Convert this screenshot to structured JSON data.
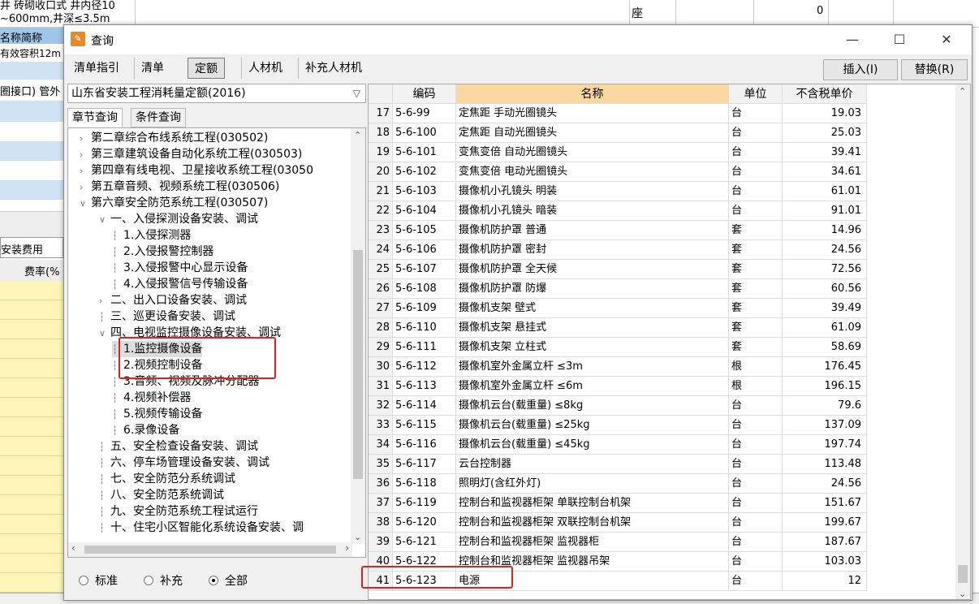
{
  "background": {
    "top_text_1": "井 砖砌收口式 井内径10",
    "top_text_2": "~600mm,井深≤3.5m",
    "top_unit": "座",
    "top_value": "0",
    "col_header": "名称简称",
    "row_a": "有效容积12m",
    "row_b": "圈接口) 管外",
    "fee_tab": "安装费用",
    "fee_rate": "费率(%"
  },
  "window": {
    "title": "查询",
    "minimize": "—",
    "maximize": "☐",
    "close": "✕"
  },
  "tabs": [
    {
      "label": "清单指引"
    },
    {
      "label": "清单"
    },
    {
      "label": "定额"
    },
    {
      "label": "人材机"
    },
    {
      "label": "补充人材机"
    }
  ],
  "buttons": {
    "insert": "插入(I)",
    "replace": "替换(R)"
  },
  "library": "山东省安装工程消耗量定额(2016)",
  "search_tabs": [
    "章节查询",
    "条件查询"
  ],
  "tree": [
    {
      "label": "第二章综合布线系统工程(030502)",
      "toggle": ">"
    },
    {
      "label": "第三章建筑设备自动化系统工程(030503)",
      "toggle": ">"
    },
    {
      "label": "第四章有线电视、卫星接收系统工程(03050",
      "toggle": ">"
    },
    {
      "label": "第五章音频、视频系统工程(030506)",
      "toggle": ">"
    },
    {
      "label": "第六章安全防范系统工程(030507)",
      "toggle": "v"
    },
    {
      "label": "一、入侵探测设备安装、调试",
      "toggle": "v"
    },
    {
      "label": "1.入侵探测器",
      "toggle": ""
    },
    {
      "label": "2.入侵报警控制器",
      "toggle": ""
    },
    {
      "label": "3.入侵报警中心显示设备",
      "toggle": ""
    },
    {
      "label": "4.入侵报警信号传输设备",
      "toggle": ""
    },
    {
      "label": "二、出入口设备安装、调试",
      "toggle": ">"
    },
    {
      "label": "三、巡更设备安装、调试",
      "toggle": ""
    },
    {
      "label": "四、电视监控摄像设备安装、调试",
      "toggle": "v"
    },
    {
      "label": "1.监控摄像设备",
      "toggle": ""
    },
    {
      "label": "2.视频控制设备",
      "toggle": ""
    },
    {
      "label": "3.音频、视频及脉冲分配器",
      "toggle": ""
    },
    {
      "label": "4.视频补偿器",
      "toggle": ""
    },
    {
      "label": "5.视频传输设备",
      "toggle": ""
    },
    {
      "label": "6.录像设备",
      "toggle": ""
    },
    {
      "label": "五、安全检查设备安装、调试",
      "toggle": ""
    },
    {
      "label": "六、停车场管理设备安装、调试",
      "toggle": ""
    },
    {
      "label": "七、安全防范分系统调试",
      "toggle": ""
    },
    {
      "label": "八、安全防范系统调试",
      "toggle": ""
    },
    {
      "label": "九、安全防范系统工程试运行",
      "toggle": ""
    },
    {
      "label": "十、住宅小区智能化系统设备安装、调",
      "toggle": ""
    }
  ],
  "selected_node": "1.监控摄像设备",
  "radios": [
    {
      "label": "标准",
      "checked": false
    },
    {
      "label": "补充",
      "checked": false
    },
    {
      "label": "全部",
      "checked": true
    }
  ],
  "table_headers": [
    "编码",
    "名称",
    "单位",
    "不含税单价"
  ],
  "rows": [
    {
      "idx": "17",
      "code": "5-6-99",
      "name": "定焦距 手动光圈镜头",
      "unit": "台",
      "price": "19.03"
    },
    {
      "idx": "18",
      "code": "5-6-100",
      "name": "定焦距 自动光圈镜头",
      "unit": "台",
      "price": "25.03"
    },
    {
      "idx": "19",
      "code": "5-6-101",
      "name": "变焦变倍 自动光圈镜头",
      "unit": "台",
      "price": "39.41"
    },
    {
      "idx": "20",
      "code": "5-6-102",
      "name": "变焦变倍 电动光圈镜头",
      "unit": "台",
      "price": "34.61"
    },
    {
      "idx": "21",
      "code": "5-6-103",
      "name": "摄像机小孔镜头 明装",
      "unit": "台",
      "price": "61.01"
    },
    {
      "idx": "22",
      "code": "5-6-104",
      "name": "摄像机小孔镜头 暗装",
      "unit": "台",
      "price": "91.01"
    },
    {
      "idx": "23",
      "code": "5-6-105",
      "name": "摄像机防护罩 普通",
      "unit": "套",
      "price": "14.96"
    },
    {
      "idx": "24",
      "code": "5-6-106",
      "name": "摄像机防护罩 密封",
      "unit": "套",
      "price": "24.56"
    },
    {
      "idx": "25",
      "code": "5-6-107",
      "name": "摄像机防护罩 全天候",
      "unit": "套",
      "price": "72.56"
    },
    {
      "idx": "26",
      "code": "5-6-108",
      "name": "摄像机防护罩 防爆",
      "unit": "套",
      "price": "60.56"
    },
    {
      "idx": "27",
      "code": "5-6-109",
      "name": "摄像机支架 壁式",
      "unit": "套",
      "price": "39.49"
    },
    {
      "idx": "28",
      "code": "5-6-110",
      "name": "摄像机支架 悬挂式",
      "unit": "套",
      "price": "61.09"
    },
    {
      "idx": "29",
      "code": "5-6-111",
      "name": "摄像机支架 立柱式",
      "unit": "套",
      "price": "58.69"
    },
    {
      "idx": "30",
      "code": "5-6-112",
      "name": "摄像机室外金属立杆 ≤3m",
      "unit": "根",
      "price": "176.45"
    },
    {
      "idx": "31",
      "code": "5-6-113",
      "name": "摄像机室外金属立杆 ≤6m",
      "unit": "根",
      "price": "196.15"
    },
    {
      "idx": "32",
      "code": "5-6-114",
      "name": "摄像机云台(载重量) ≤8kg",
      "unit": "台",
      "price": "79.6"
    },
    {
      "idx": "33",
      "code": "5-6-115",
      "name": "摄像机云台(载重量) ≤25kg",
      "unit": "台",
      "price": "137.09"
    },
    {
      "idx": "34",
      "code": "5-6-116",
      "name": "摄像机云台(载重量) ≤45kg",
      "unit": "台",
      "price": "197.74"
    },
    {
      "idx": "35",
      "code": "5-6-117",
      "name": "云台控制器",
      "unit": "台",
      "price": "113.48"
    },
    {
      "idx": "36",
      "code": "5-6-118",
      "name": "照明灯(含红外灯)",
      "unit": "台",
      "price": "24.56"
    },
    {
      "idx": "37",
      "code": "5-6-119",
      "name": "控制台和监视器柜架 单联控制台机架",
      "unit": "台",
      "price": "151.67"
    },
    {
      "idx": "38",
      "code": "5-6-120",
      "name": "控制台和监视器柜架 双联控制台机架",
      "unit": "台",
      "price": "199.67"
    },
    {
      "idx": "39",
      "code": "5-6-121",
      "name": "控制台和监视器柜架 监视器柜",
      "unit": "台",
      "price": "187.67"
    },
    {
      "idx": "40",
      "code": "5-6-122",
      "name": "控制台和监视器柜架 监视器吊架",
      "unit": "台",
      "price": "103.03"
    },
    {
      "idx": "41",
      "code": "5-6-123",
      "name": "电源",
      "unit": "台",
      "price": "12"
    }
  ],
  "colors": {
    "highlight_box": "#e02020",
    "name_header": "#fad8a0",
    "bg_blue": "#cfe3f5",
    "bg_yellow": "#fdf5b8"
  }
}
